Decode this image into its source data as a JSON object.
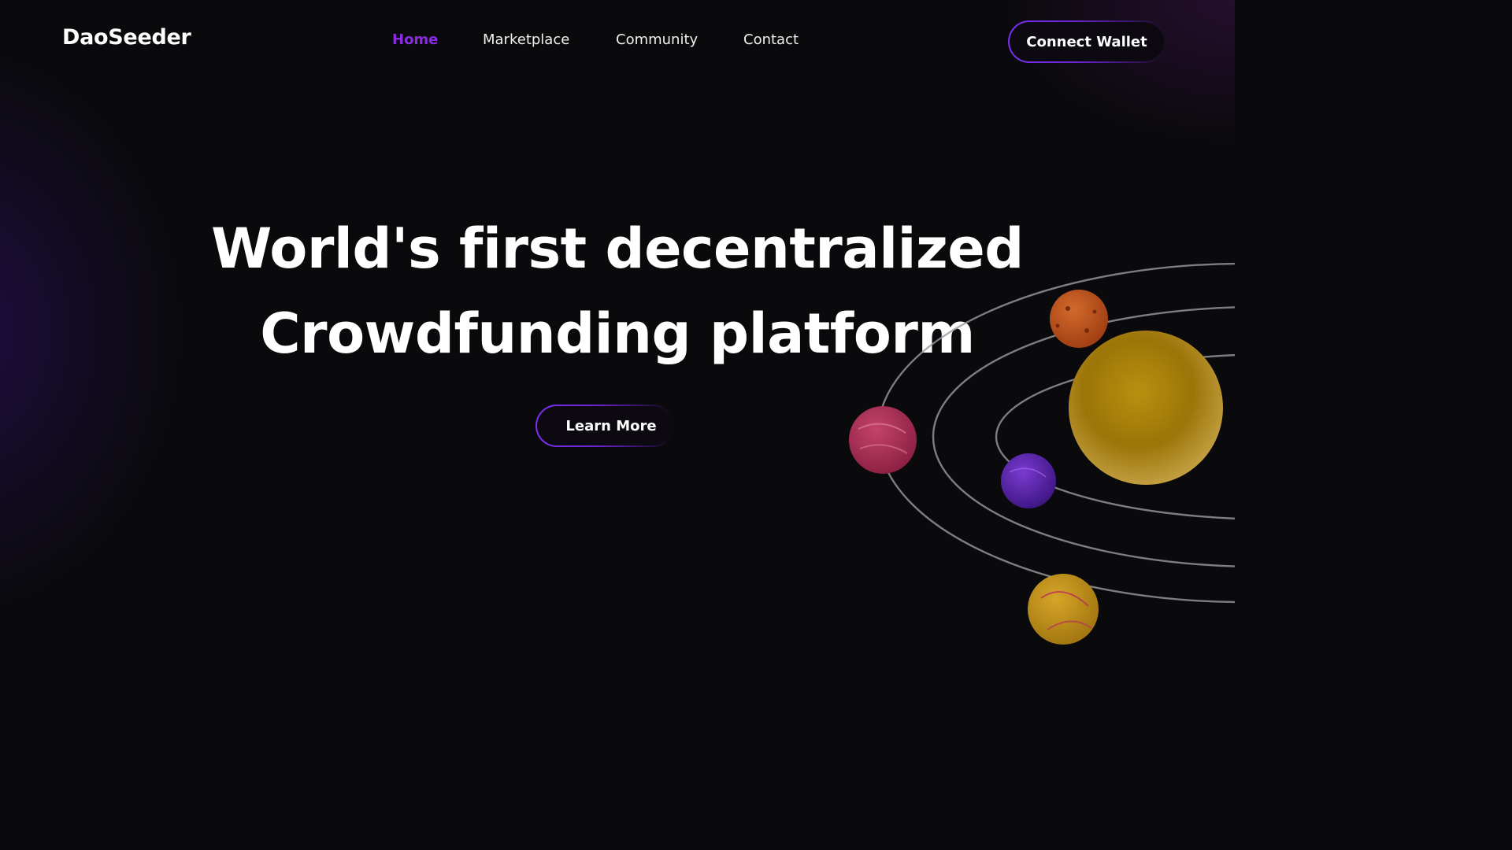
{
  "nav": {
    "logo": "DaoSeeder",
    "links": [
      {
        "label": "Home",
        "active": true
      },
      {
        "label": "Marketplace",
        "active": false
      },
      {
        "label": "Community",
        "active": false
      },
      {
        "label": "Contact",
        "active": false
      }
    ],
    "connect_label": "Connect Wallet"
  },
  "hero": {
    "title_line1": "World's first decentralized",
    "title_line2": "Crowdfunding platform",
    "cta_label": "Learn More"
  },
  "illustration": {
    "planets": [
      "orange-planet",
      "golden-sun",
      "pink-planet",
      "purple-planet",
      "yellow-planet"
    ]
  },
  "colors": {
    "accent": "#8a2be2",
    "background": "#0a0a0c",
    "text": "#ffffff"
  }
}
